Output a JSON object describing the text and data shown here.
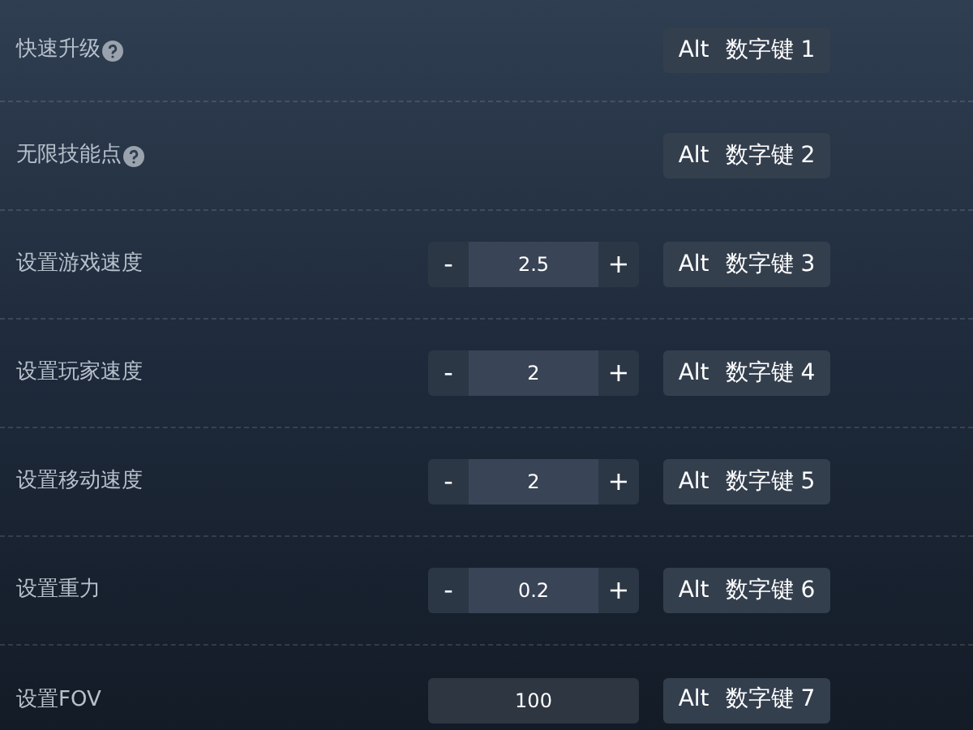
{
  "settings": [
    {
      "label": "快速升级",
      "help": true,
      "kind": "toggle",
      "hotkey": [
        "Alt",
        "数字键 1"
      ]
    },
    {
      "label": "无限技能点",
      "help": true,
      "kind": "toggle",
      "hotkey": [
        "Alt",
        "数字键 2"
      ]
    },
    {
      "label": "设置游戏速度",
      "kind": "stepper",
      "minus": "-",
      "value": "2.5",
      "plus": "+",
      "hotkey": [
        "Alt",
        "数字键 3"
      ]
    },
    {
      "label": "设置玩家速度",
      "kind": "stepper",
      "minus": "-",
      "value": "2",
      "plus": "+",
      "hotkey": [
        "Alt",
        "数字键 4"
      ]
    },
    {
      "label": "设置移动速度",
      "kind": "stepper",
      "minus": "-",
      "value": "2",
      "plus": "+",
      "hotkey": [
        "Alt",
        "数字键 5"
      ]
    },
    {
      "label": "设置重力",
      "kind": "stepper",
      "minus": "-",
      "value": "0.2",
      "plus": "+",
      "hotkey": [
        "Alt",
        "数字键 6"
      ]
    },
    {
      "label": "设置FOV",
      "kind": "input",
      "value": "100",
      "hotkey": [
        "Alt",
        "数字键 7"
      ]
    }
  ]
}
